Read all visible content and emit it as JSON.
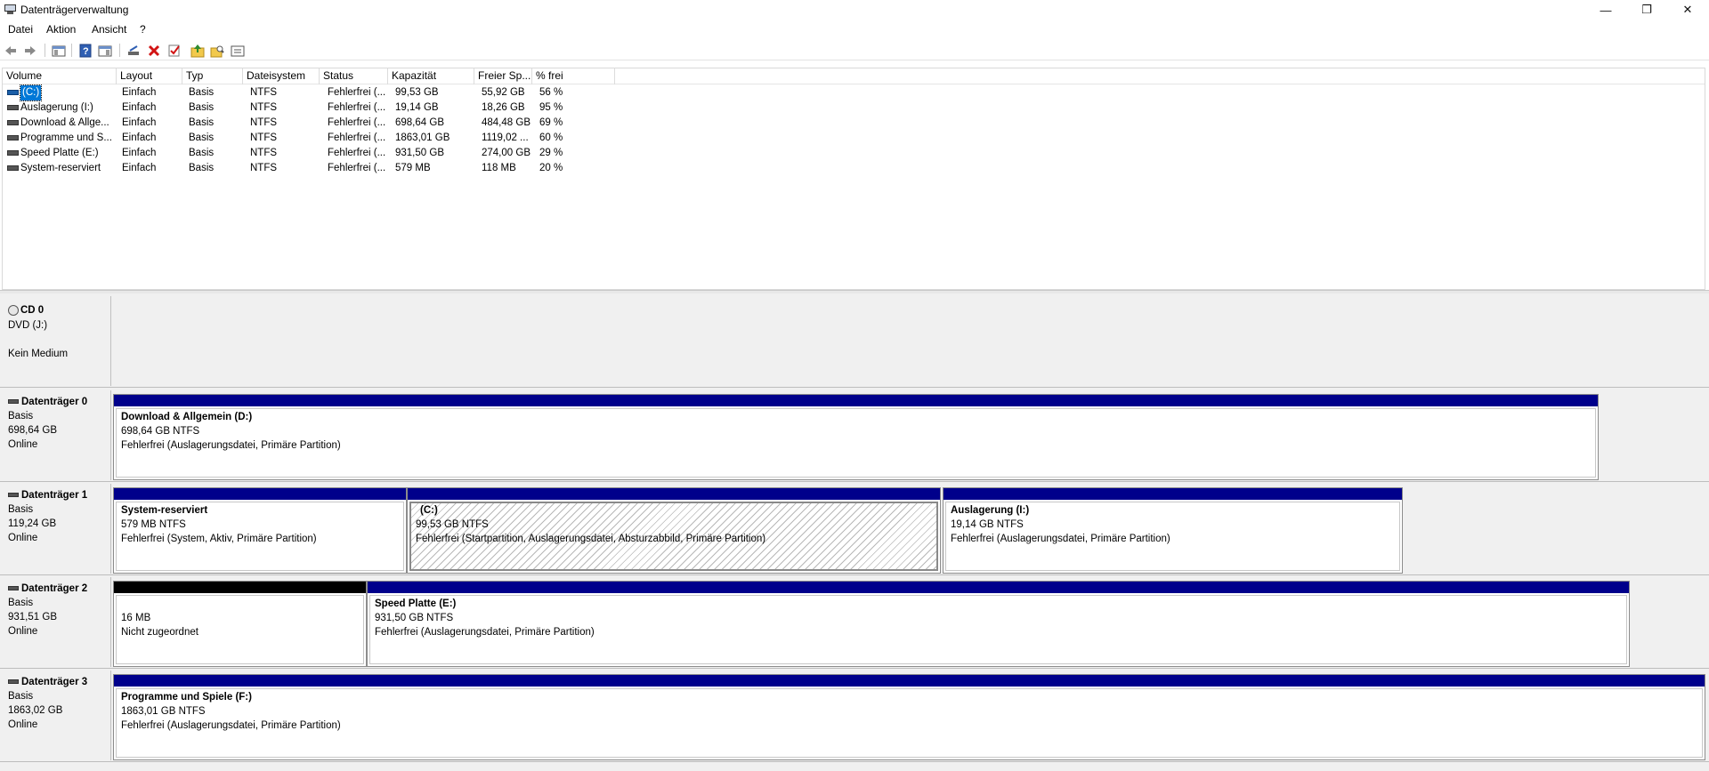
{
  "window": {
    "title": "Datenträgerverwaltung",
    "controls": {
      "minimize": "—",
      "restore": "❐",
      "close": "✕"
    }
  },
  "menu": [
    "Datei",
    "Aktion",
    "Ansicht",
    "?"
  ],
  "toolbar": {
    "icons": [
      "back-arrow-icon",
      "forward-arrow-icon",
      "console-tree-icon",
      "help-icon",
      "properties-icon",
      "connect-disk-icon",
      "delete-icon",
      "check-icon",
      "folder-up-icon",
      "folder-search-icon",
      "list-view-icon"
    ]
  },
  "volume_list": {
    "columns": [
      "Volume",
      "Layout",
      "Typ",
      "Dateisystem",
      "Status",
      "Kapazität",
      "Freier Sp...",
      "% frei"
    ],
    "rows": [
      [
        "(C:)",
        "Einfach",
        "Basis",
        "NTFS",
        "Fehlerfrei (...",
        "99,53 GB",
        "55,92 GB",
        "56 %"
      ],
      [
        "Auslagerung (I:)",
        "Einfach",
        "Basis",
        "NTFS",
        "Fehlerfrei (...",
        "19,14 GB",
        "18,26 GB",
        "95 %"
      ],
      [
        "Download & Allge...",
        "Einfach",
        "Basis",
        "NTFS",
        "Fehlerfrei (...",
        "698,64 GB",
        "484,48 GB",
        "69 %"
      ],
      [
        "Programme und S...",
        "Einfach",
        "Basis",
        "NTFS",
        "Fehlerfrei (...",
        "1863,01 GB",
        "1119,02 ...",
        "60 %"
      ],
      [
        "Speed Platte (E:)",
        "Einfach",
        "Basis",
        "NTFS",
        "Fehlerfrei (...",
        "931,50 GB",
        "274,00 GB",
        "29 %"
      ],
      [
        "System-reserviert",
        "Einfach",
        "Basis",
        "NTFS",
        "Fehlerfrei (...",
        "579 MB",
        "118 MB",
        "20 %"
      ]
    ],
    "selected_row": 0
  },
  "disks": [
    {
      "name": "CD 0",
      "line1": "DVD (J:)",
      "line2": "",
      "line3": "Kein Medium",
      "partitions": []
    },
    {
      "name": "Datenträger 0",
      "line1": "Basis",
      "line2": "698,64 GB",
      "line3": "Online",
      "partitions": [
        {
          "title": "Download & Allgemein  (D:)",
          "size": "698,64 GB NTFS",
          "status": "Fehlerfrei (Auslagerungsdatei, Primäre Partition)"
        }
      ]
    },
    {
      "name": "Datenträger 1",
      "line1": "Basis",
      "line2": "119,24 GB",
      "line3": "Online",
      "partitions": [
        {
          "title": "System-reserviert",
          "size": "579 MB NTFS",
          "status": "Fehlerfrei (System, Aktiv, Primäre Partition)"
        },
        {
          "title": "(C:)",
          "size": "99,53 GB NTFS",
          "status": "Fehlerfrei (Startpartition, Auslagerungsdatei, Absturzabbild, Primäre Partition)"
        },
        {
          "title": "Auslagerung  (I:)",
          "size": "19,14 GB NTFS",
          "status": "Fehlerfrei (Auslagerungsdatei, Primäre Partition)"
        }
      ]
    },
    {
      "name": "Datenträger 2",
      "line1": "Basis",
      "line2": "931,51 GB",
      "line3": "Online",
      "partitions": [
        {
          "title": "",
          "size": "16 MB",
          "status": "Nicht zugeordnet"
        },
        {
          "title": "Speed Platte  (E:)",
          "size": "931,50 GB NTFS",
          "status": "Fehlerfrei (Auslagerungsdatei, Primäre Partition)"
        }
      ]
    },
    {
      "name": "Datenträger 3",
      "line1": "Basis",
      "line2": "1863,02 GB",
      "line3": "Online",
      "partitions": [
        {
          "title": "Programme und Spiele  (F:)",
          "size": "1863,01 GB NTFS",
          "status": "Fehlerfrei (Auslagerungsdatei, Primäre Partition)"
        }
      ]
    }
  ],
  "colors": {
    "primary_partition_bar": "#00008b",
    "unallocated_bar": "#000000",
    "selection": "#0078d7"
  }
}
